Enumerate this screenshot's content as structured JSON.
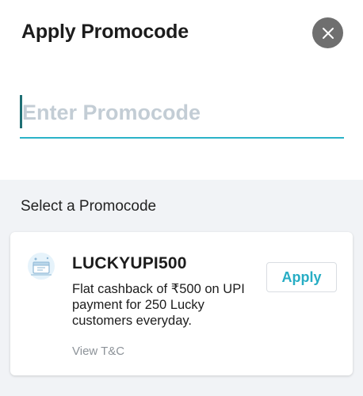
{
  "header": {
    "title": "Apply Promocode"
  },
  "promo_input": {
    "value": "",
    "placeholder": "Enter Promocode"
  },
  "list": {
    "title": "Select a Promocode",
    "items": [
      {
        "code": "LUCKYUPI500",
        "description": "Flat cashback of ₹500 on UPI payment for 250 Lucky customers everyday.",
        "apply_label": "Apply",
        "terms_label": "View T&C",
        "icon": "coupon-icon"
      }
    ]
  },
  "colors": {
    "accent": "#27adc4",
    "close_button": "#6f6f6f",
    "section_background": "#f1f3f6",
    "placeholder": "#c3cdd5"
  }
}
